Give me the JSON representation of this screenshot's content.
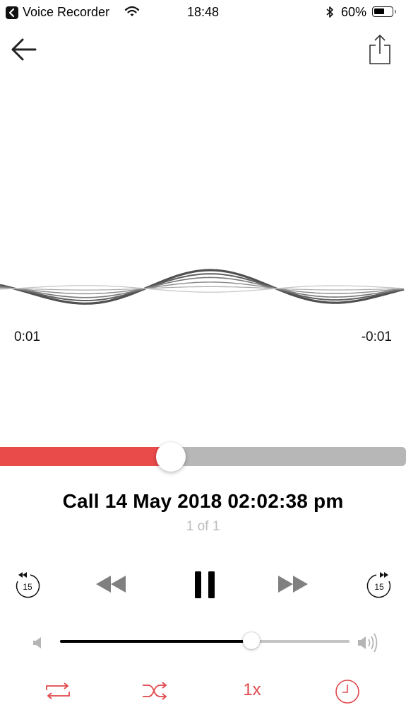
{
  "status_bar": {
    "back_app_label": "Voice Recorder",
    "time": "18:48",
    "battery_percent_label": "60%",
    "battery_level": 0.6,
    "icons": [
      "back-app-icon",
      "wifi-icon",
      "bluetooth-icon",
      "battery-icon"
    ]
  },
  "nav": {
    "back_icon": "arrow-left-icon",
    "share_icon": "share-icon"
  },
  "playback": {
    "elapsed": "0:01",
    "remaining": "-0:01",
    "progress": 0.42
  },
  "recording": {
    "title": "Call 14 May 2018 02:02:38 pm",
    "position": "1 of 1"
  },
  "controls": {
    "skip_back_seconds": "15",
    "skip_forward_seconds": "15",
    "state": "playing",
    "icons": [
      "skip-back-15-icon",
      "rewind-icon",
      "pause-icon",
      "fast-forward-icon",
      "skip-forward-15-icon"
    ]
  },
  "volume": {
    "level": 0.66,
    "icons": [
      "volume-low-icon",
      "volume-high-icon"
    ]
  },
  "bottom_bar": {
    "speed_label": "1x",
    "icons": [
      "repeat-icon",
      "shuffle-icon",
      "timer-icon"
    ]
  },
  "colors": {
    "accent": "#e94a4a",
    "bottom_icons": "#e0484b",
    "track_inactive": "#b7b7b7",
    "secondary_text": "#bdbdbd",
    "waveform": "#555555"
  }
}
